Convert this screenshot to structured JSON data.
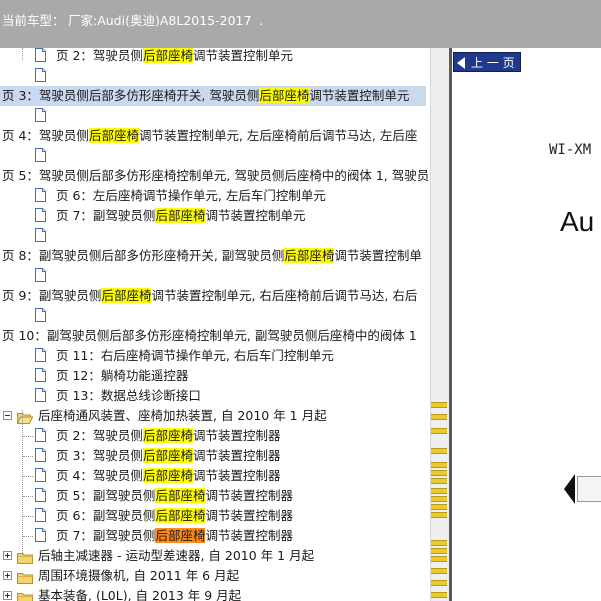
{
  "header": {
    "label": "当前车型：",
    "value": "厂家:Audi(奥迪)A8L2015-2017  ."
  },
  "tree": {
    "rows": [
      {
        "kind": "page",
        "pre": "页 2：驾驶员侧",
        "hl": "后部座椅",
        "post": "调节装置控制单元"
      },
      {
        "kind": "page",
        "pre": "",
        "hl": "",
        "post": ""
      },
      {
        "kind": "text",
        "pre": "页 3：驾驶员侧后部多仿形座椅开关, 驾驶员侧",
        "hl": "后部座椅",
        "post": "调节装置控制单元",
        "selected": true
      },
      {
        "kind": "page",
        "pre": "",
        "hl": "",
        "post": ""
      },
      {
        "kind": "text",
        "pre": "页 4：驾驶员侧",
        "hl": "后部座椅",
        "post": "调节装置控制单元, 左后座椅前后调节马达, 左后座"
      },
      {
        "kind": "page",
        "pre": "",
        "hl": "",
        "post": ""
      },
      {
        "kind": "text",
        "pre": "页 5：驾驶员侧后部多仿形座椅控制单元, 驾驶员侧后座椅中的阀体 1, 驾驶员",
        "hl": "",
        "post": ""
      },
      {
        "kind": "page",
        "pre": "页 6：左后座椅调节操作单元, 左后车门控制单元",
        "hl": "",
        "post": ""
      },
      {
        "kind": "page",
        "pre": "页 7：副驾驶员侧",
        "hl": "后部座椅",
        "post": "调节装置控制单元"
      },
      {
        "kind": "page",
        "pre": "",
        "hl": "",
        "post": ""
      },
      {
        "kind": "text",
        "pre": "页 8：副驾驶员侧后部多仿形座椅开关, 副驾驶员侧",
        "hl": "后部座椅",
        "post": "调节装置控制单"
      },
      {
        "kind": "page",
        "pre": "",
        "hl": "",
        "post": ""
      },
      {
        "kind": "text",
        "pre": "页 9：副驾驶员侧",
        "hl": "后部座椅",
        "post": "调节装置控制单元, 右后座椅前后调节马达, 右后"
      },
      {
        "kind": "page",
        "pre": "",
        "hl": "",
        "post": ""
      },
      {
        "kind": "text",
        "pre": "页 10：副驾驶员侧后部多仿形座椅控制单元, 副驾驶员侧后座椅中的阀体 1",
        "hl": "",
        "post": ""
      },
      {
        "kind": "page",
        "pre": "页 11：右后座椅调节操作单元, 右后车门控制单元",
        "hl": "",
        "post": ""
      },
      {
        "kind": "page",
        "pre": "页 12：躺椅功能遥控器",
        "hl": "",
        "post": ""
      },
      {
        "kind": "page",
        "pre": "页 13：数据总线诊断接口",
        "hl": "",
        "post": ""
      },
      {
        "kind": "folder-open",
        "pre": "后座椅通风装置、座椅加热装置, 自 2010 年 1 月起",
        "hl": "",
        "post": ""
      },
      {
        "kind": "child",
        "pre": "页 2：驾驶员侧",
        "hl": "后部座椅",
        "post": "调节装置控制器"
      },
      {
        "kind": "child",
        "pre": "页 3：驾驶员侧",
        "hl": "后部座椅",
        "post": "调节装置控制器"
      },
      {
        "kind": "child",
        "pre": "页 4：驾驶员侧",
        "hl": "后部座椅",
        "post": "调节装置控制器"
      },
      {
        "kind": "child",
        "pre": "页 5：副驾驶员侧",
        "hl": "后部座椅",
        "post": "调节装置控制器"
      },
      {
        "kind": "child",
        "pre": "页 6：副驾驶员侧",
        "hl": "后部座椅",
        "post": "调节装置控制器"
      },
      {
        "kind": "child",
        "pre": "页 7：副驾驶员侧",
        "hl": "后部座椅",
        "post": "调节装置控制器",
        "current": true
      },
      {
        "kind": "folder",
        "pre": "后轴主减速器 - 运动型差速器, 自 2010 年 1 月起",
        "hl": "",
        "post": ""
      },
      {
        "kind": "folder",
        "pre": "周围环境摄像机, 自 2011 年 6 月起",
        "hl": "",
        "post": ""
      },
      {
        "kind": "folder",
        "pre": "基本装备, (L0L), 自 2013 年 9 月起",
        "hl": "",
        "post": ""
      },
      {
        "kind": "folder",
        "pre": "基本装备, 右置方向盘, (L0R), 自 2013 年 9 月起",
        "hl": "",
        "post": ""
      }
    ]
  },
  "doc": {
    "prev_label": "上 一 页",
    "line1": "WI-XM",
    "line2": "Au"
  },
  "colors": {
    "highlight": "#ffff00",
    "current": "#ff8c1a",
    "selected": "#c9d9ef",
    "button": "#1f3a8c"
  }
}
